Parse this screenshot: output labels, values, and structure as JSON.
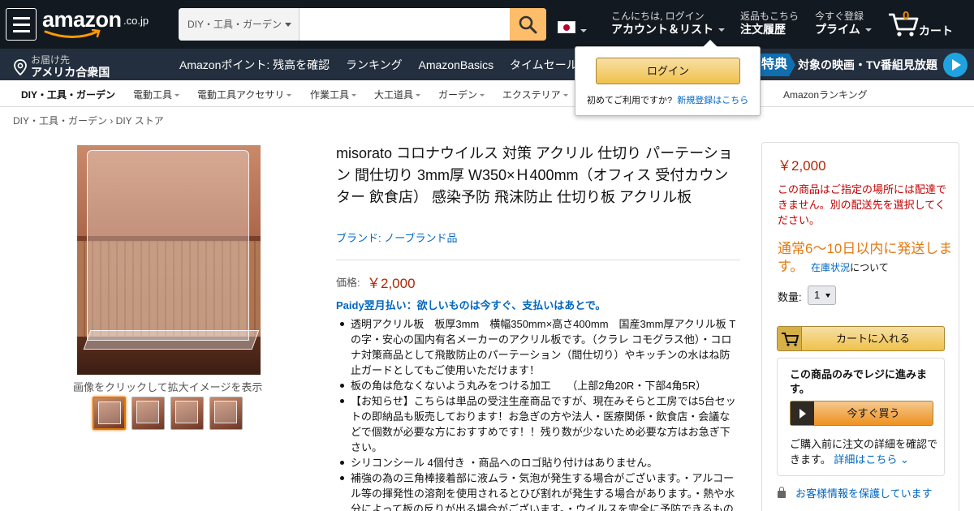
{
  "header": {
    "logo": "amazon",
    "logo_suffix": ".co.jp",
    "search": {
      "category": "DIY・工具・ガーデン",
      "value": "",
      "placeholder": ""
    },
    "account": {
      "greeting": "こんにちは, ログイン",
      "label": "アカウント＆リスト"
    },
    "orders": {
      "line1": "返品もこちら",
      "line2": "注文履歴"
    },
    "prime": {
      "line1": "今すぐ登録",
      "line2": "プライム"
    },
    "cart": {
      "count": "0",
      "label": "カート"
    }
  },
  "nav": {
    "deliver_line1": "お届け先",
    "deliver_line2": "アメリカ合衆国",
    "links": [
      "Amazonポイント: 残高を確認",
      "ランキング",
      "AmazonBasics",
      "タイムセール"
    ],
    "promo_badge": "特典",
    "promo_text": "対象の映画・TV番組見放題"
  },
  "subnav": {
    "items": [
      "DIY・工具・ガーデン",
      "電動工具",
      "電動工具アクセサリ",
      "作業工具",
      "大工道具",
      "ガーデン",
      "エクステリア",
      "Amazonランキング"
    ]
  },
  "popover": {
    "login_label": "ログイン",
    "new_customer_text": "初めてご利用ですか?",
    "register_link": "新規登録はこちら"
  },
  "breadcrumb": "DIY・工具・ガーデン › DIY ストア",
  "image": {
    "caption": "画像をクリックして拡大イメージを表示"
  },
  "product": {
    "title": "misorato コロナウイルス 対策 アクリル 仕切り パーテーション 間仕切り 3mm厚 W350×Ｈ400mm（オフィス 受付カウンター 飲食店） 感染予防 飛沫防止 仕切り板 アクリル板",
    "brand": "ブランド: ノーブランド品",
    "price_label": "価格:",
    "price": "￥2,000",
    "paidy": "Paidy翌月払い：欲しいものは今すぐ、支払いはあとで。",
    "bullets": [
      "透明アクリル板　板厚3mm　横幅350mm×高さ400mm　国産3mm厚アクリル板 Tの字・安心の国内有名メーカーのアクリル板です。（クラレ コモグラス他）・コロナ対策商品として飛散防止のパーテーション（間仕切り）やキッチンの水はね防止ガードとしてもご使用いただけます！",
      "板の角は危なくないよう丸みをつける加工　　（上部2角20R・下部4角5R）",
      "【お知らせ】こちらは単品の受注生産商品ですが、現在みそらと工房では5台セットの即納品も販売しております！お急ぎの方や法人・医療関係・飲食店・会議などで個数が必要な方におすすめです！！残り数が少ないため必要な方はお急ぎ下さい。",
      "シリコンシール 4個付き ・商品へのロゴ貼り付けはありません。",
      "補強の為の三角棒接着部に液ムラ・気泡が発生する場合がございます。・アルコール等の揮発性の溶剤を使用されるとひび割れが発生する場合があります。・熱や水分によって板の反りが出る場合がございます。・ウイルスを完全に予防できるものではありません。"
    ]
  },
  "buybox": {
    "price": "￥2,000",
    "warning": "この商品はご指定の場所には配達できません。別の配送先を選択してください。",
    "shipping": "通常6～10日以内に発送します。",
    "stock_link": "在庫状況",
    "stock_suffix": "について",
    "qty_label": "数量:",
    "qty_value": "1",
    "add_to_cart": "カートに入れる",
    "buy_now_title": "この商品のみでレジに進みます。",
    "buy_now_label": "今すぐ買う",
    "buy_now_desc": "ご購入前に注文の詳細を確認できます。",
    "buy_now_link": "詳細はこちら",
    "secure": "お客様情報を保護しています"
  },
  "colors": {
    "nav_dark": "#131921",
    "nav_mid": "#232f3e",
    "search_button": "#febd69",
    "price": "#b12704",
    "link": "#0066c0",
    "shipping": "#e47911",
    "warning": "#c40000",
    "cart_count": "#f08804"
  },
  "icons": [
    "hamburger-icon",
    "search-icon",
    "flag-jp-icon",
    "cart-icon",
    "location-pin-icon",
    "play-icon",
    "lock-icon"
  ]
}
